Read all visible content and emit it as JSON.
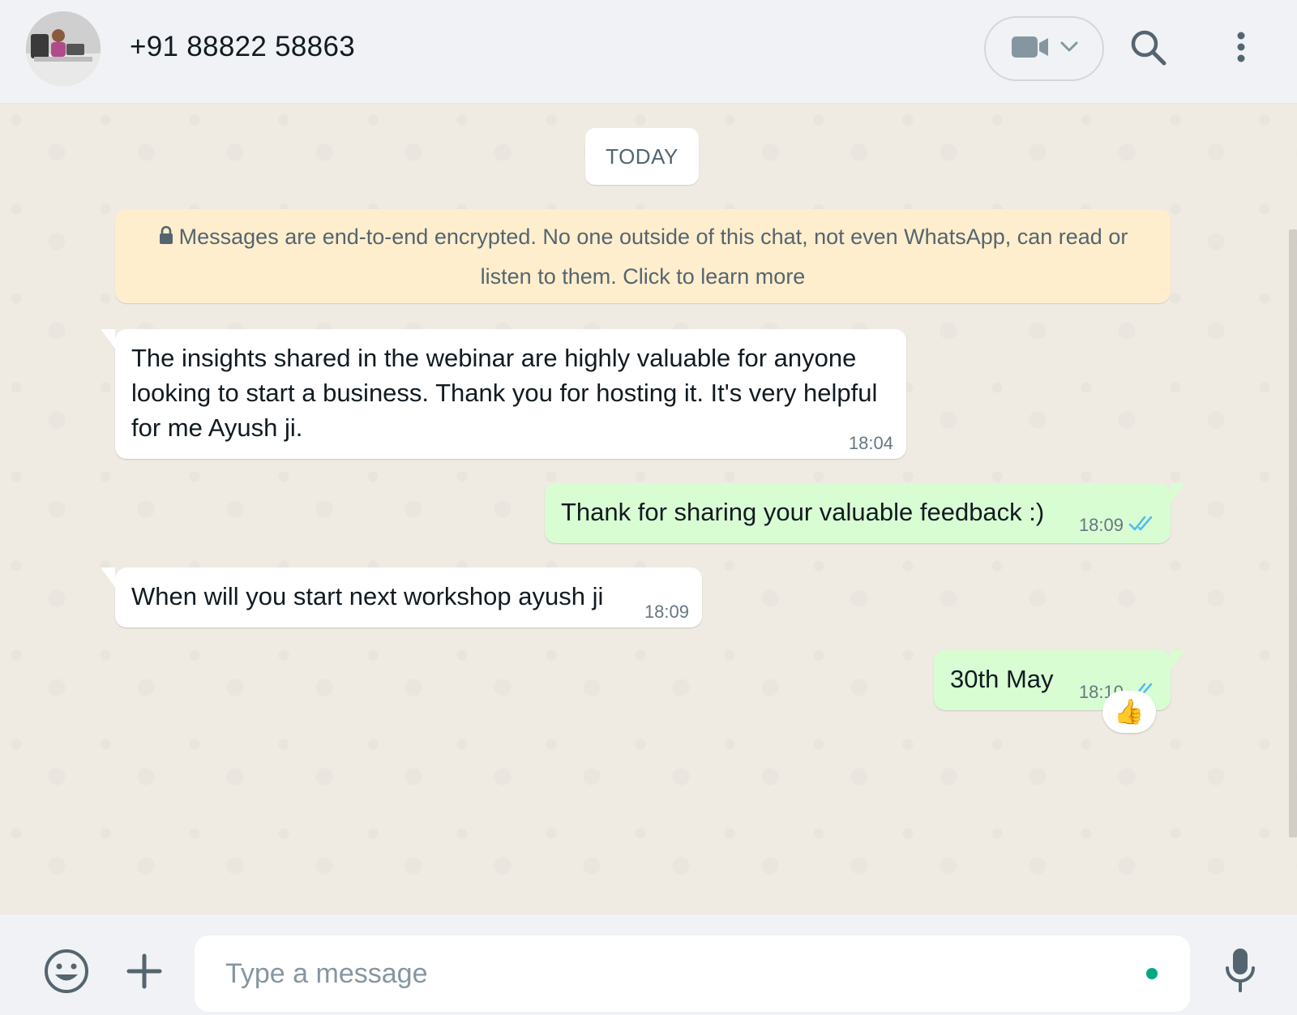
{
  "header": {
    "contact_name": "+91 88822 58863"
  },
  "chat": {
    "date_label": "TODAY",
    "encryption_notice": "Messages are end-to-end encrypted. No one outside of this chat, not even WhatsApp, can read or listen to them. Click to learn more",
    "messages": [
      {
        "direction": "incoming",
        "text": "The insights shared in the webinar are highly valuable for anyone looking to start a business. Thank you for hosting it. It's very helpful for me Ayush ji.",
        "time": "18:04"
      },
      {
        "direction": "outgoing",
        "text": "Thank for sharing your valuable feedback :)",
        "time": "18:09",
        "status": "read"
      },
      {
        "direction": "incoming",
        "text": "When will you start next workshop ayush ji",
        "time": "18:09"
      },
      {
        "direction": "outgoing",
        "text": "30th May",
        "time": "18:10",
        "status": "read",
        "reaction": "👍"
      }
    ]
  },
  "composer": {
    "placeholder": "Type a message",
    "value": ""
  },
  "colors": {
    "header_bg": "#f0f2f5",
    "chat_bg": "#efeae2",
    "incoming_bubble": "#ffffff",
    "outgoing_bubble": "#d9fdd3",
    "encryption_bg": "#ffeecd",
    "read_ticks": "#53bdeb",
    "accent": "#00a884"
  },
  "icons": {
    "video_call": "video-camera-icon",
    "dropdown": "chevron-down-icon",
    "search": "search-icon",
    "menu": "kebab-menu-icon",
    "emoji": "smiley-icon",
    "attach": "plus-icon",
    "voice": "microphone-icon",
    "lock": "lock-icon",
    "read_receipt": "double-check-icon"
  }
}
